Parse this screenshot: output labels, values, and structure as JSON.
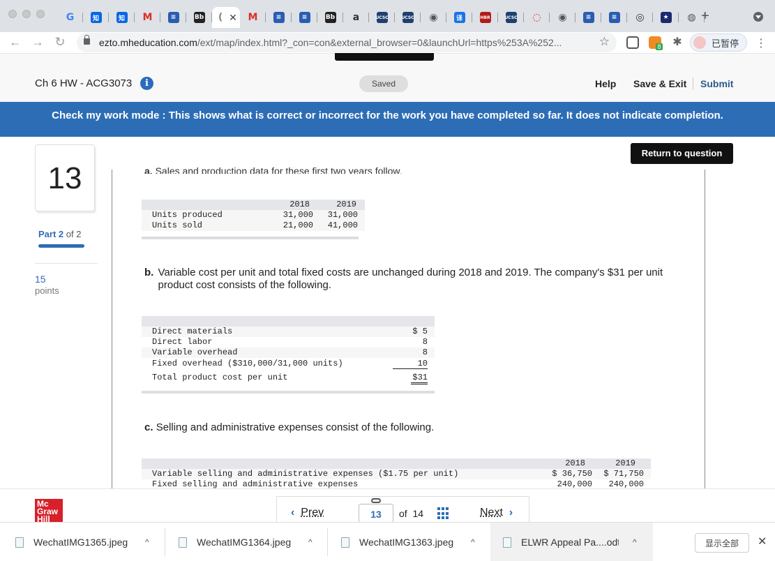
{
  "browser": {
    "tabs": [
      {
        "icon": "google-icon",
        "glyph": "G",
        "color": "#4285f4"
      },
      {
        "icon": "zhihu-icon",
        "glyph": "知",
        "color": "#0a66e4"
      },
      {
        "icon": "zhihu-icon",
        "glyph": "知",
        "color": "#0a66e4"
      },
      {
        "icon": "gmail-icon",
        "glyph": "M",
        "color": "#d93025"
      },
      {
        "icon": "mheducation-icon",
        "glyph": "≡",
        "color": "#2a5db0"
      },
      {
        "icon": "blackboard-icon",
        "glyph": "Bb",
        "color": "#222222"
      },
      {
        "icon": "active-tab-icon",
        "glyph": "(",
        "color": "#888888"
      },
      {
        "icon": "gmail-icon",
        "glyph": "M",
        "color": "#d93025"
      },
      {
        "icon": "mheducation-icon",
        "glyph": "≡",
        "color": "#2a5db0"
      },
      {
        "icon": "mheducation-icon",
        "glyph": "≡",
        "color": "#2a5db0"
      },
      {
        "icon": "blackboard-icon",
        "glyph": "Bb",
        "color": "#222222"
      },
      {
        "icon": "amazon-icon",
        "glyph": "a",
        "color": "#333333"
      },
      {
        "icon": "ucsc-icon",
        "glyph": "UCSC",
        "color": "#1f3f6e"
      },
      {
        "icon": "ucsc-icon",
        "glyph": "UCSC",
        "color": "#1f3f6e"
      },
      {
        "icon": "globe-icon",
        "glyph": "◉",
        "color": "#555555"
      },
      {
        "icon": "translate-icon",
        "glyph": "译",
        "color": "#1a73e8"
      },
      {
        "icon": "hbr-icon",
        "glyph": "HBR",
        "color": "#b31b1b"
      },
      {
        "icon": "ucsc-icon",
        "glyph": "UCSC",
        "color": "#1f3f6e"
      },
      {
        "icon": "ring-icon",
        "glyph": "◌",
        "color": "#d93025"
      },
      {
        "icon": "globe-icon",
        "glyph": "◉",
        "color": "#555555"
      },
      {
        "icon": "mheducation-icon",
        "glyph": "≡",
        "color": "#2a5db0"
      },
      {
        "icon": "mheducation-icon",
        "glyph": "≡",
        "color": "#2a5db0"
      },
      {
        "icon": "compass-icon",
        "glyph": "◎",
        "color": "#333333"
      },
      {
        "icon": "star-badge-icon",
        "glyph": "★",
        "color": "#1a2a6c"
      },
      {
        "icon": "chrome-icon",
        "glyph": "◍",
        "color": "#555555"
      }
    ],
    "url_domain": "ezto.mheducation.com",
    "url_rest": "/ext/map/index.html?_con=con&external_browser=0&launchUrl=https%253A%252...",
    "extension_badge": "8",
    "profile_label": "已暂停"
  },
  "header": {
    "title": "Ch 6 HW - ACG3073",
    "status": "Saved",
    "help": "Help",
    "save_exit": "Save & Exit",
    "submit": "Submit"
  },
  "banner": "Check my work mode : This shows what is correct or incorrect for the work you have completed so far. It does not indicate completion.",
  "sidebar": {
    "question_number": "13",
    "part_label": "Part 2",
    "part_of": "of 2",
    "points": "15",
    "points_label": "points"
  },
  "content": {
    "return_button": "Return to question",
    "cut_text_prefix": "a.",
    "cut_text": "Sales and production data for these first two years follow.",
    "table_a": {
      "years": [
        "2018",
        "2019"
      ],
      "rows": [
        {
          "label": "Units produced",
          "values": [
            "31,000",
            "31,000"
          ]
        },
        {
          "label": "Units sold",
          "values": [
            "21,000",
            "41,000"
          ]
        }
      ]
    },
    "para_b_prefix": "b.",
    "para_b": "Variable cost per unit and total fixed costs are unchanged during 2018 and 2019. The company's $31 per unit product cost consists of the following.",
    "table_b": {
      "rows": [
        {
          "label": "Direct materials",
          "value": "$ 5"
        },
        {
          "label": "Direct labor",
          "value": "8"
        },
        {
          "label": "Variable overhead",
          "value": "8"
        },
        {
          "label": "Fixed overhead ($310,000/31,000 units)",
          "value": "10"
        },
        {
          "label": "Total product cost per unit",
          "value": "$31"
        }
      ]
    },
    "para_c_prefix": "c.",
    "para_c": "Selling and administrative expenses consist of the following.",
    "table_c": {
      "years": [
        "2018",
        "2019"
      ],
      "rows": [
        {
          "label": "Variable selling and administrative expenses ($1.75 per unit)",
          "values": [
            "$ 36,750",
            "$ 71,750"
          ]
        },
        {
          "label": "Fixed selling and administrative expenses",
          "values": [
            "240,000",
            "240,000"
          ]
        }
      ]
    }
  },
  "pager": {
    "prev": "Prev",
    "current": "13",
    "of": "of",
    "total": "14",
    "next": "Next",
    "logo": "Mc Graw Hill"
  },
  "downloads": {
    "items": [
      "WechatIMG1365.jpeg",
      "WechatIMG1364.jpeg",
      "WechatIMG1363.jpeg",
      "ELWR  Appeal Pa....odt"
    ],
    "show_all": "显示全部"
  }
}
